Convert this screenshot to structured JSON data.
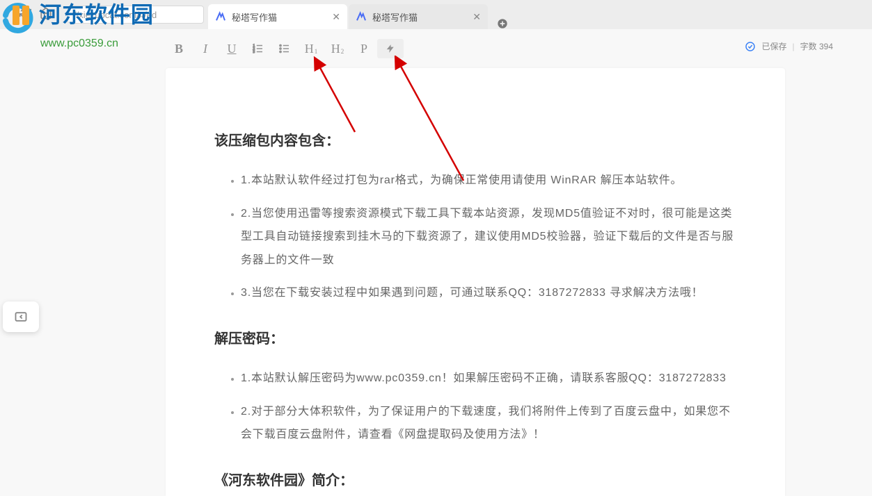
{
  "browser": {
    "url": "//xiezuocat.com/#/ed",
    "tabs": [
      {
        "title": "秘塔写作猫",
        "active": true
      },
      {
        "title": "秘塔写作猫",
        "active": false
      }
    ]
  },
  "watermark": {
    "brand": "河东软件园",
    "url": "www.pc0359.cn"
  },
  "toolbar": {
    "bold": "B",
    "italic": "I",
    "underline": "U",
    "ol_label": "ordered-list",
    "ul_label": "unordered-list",
    "h1": "H",
    "h1_sub": "1",
    "h2": "H",
    "h2_sub": "2",
    "p": "P",
    "lightning": "⚡"
  },
  "status": {
    "saved_label": "已保存",
    "wordcount_label": "字数",
    "wordcount_value": "394"
  },
  "doc": {
    "heading1": "该压缩包内容包含：",
    "list1": [
      "1.本站默认软件经过打包为rar格式，为确保正常使用请使用 WinRAR 解压本站软件。",
      "2.当您使用迅雷等搜索资源模式下载工具下载本站资源，发现MD5值验证不对时，很可能是这类型工具自动链接搜索到挂木马的下载资源了，建议使用MD5校验器，验证下载后的文件是否与服务器上的文件一致",
      "3.当您在下载安装过程中如果遇到问题，可通过联系QQ：3187272833 寻求解决方法哦！"
    ],
    "heading2": "解压密码：",
    "list2": [
      "1.本站默认解压密码为www.pc0359.cn！如果解压密码不正确，请联系客服QQ：3187272833",
      "2.对于部分大体积软件，为了保证用户的下载速度，我们将附件上传到了百度云盘中，如果您不会下载百度云盘附件，请查看《网盘提取码及使用方法》！"
    ],
    "heading3": "《河东软件园》简介："
  }
}
